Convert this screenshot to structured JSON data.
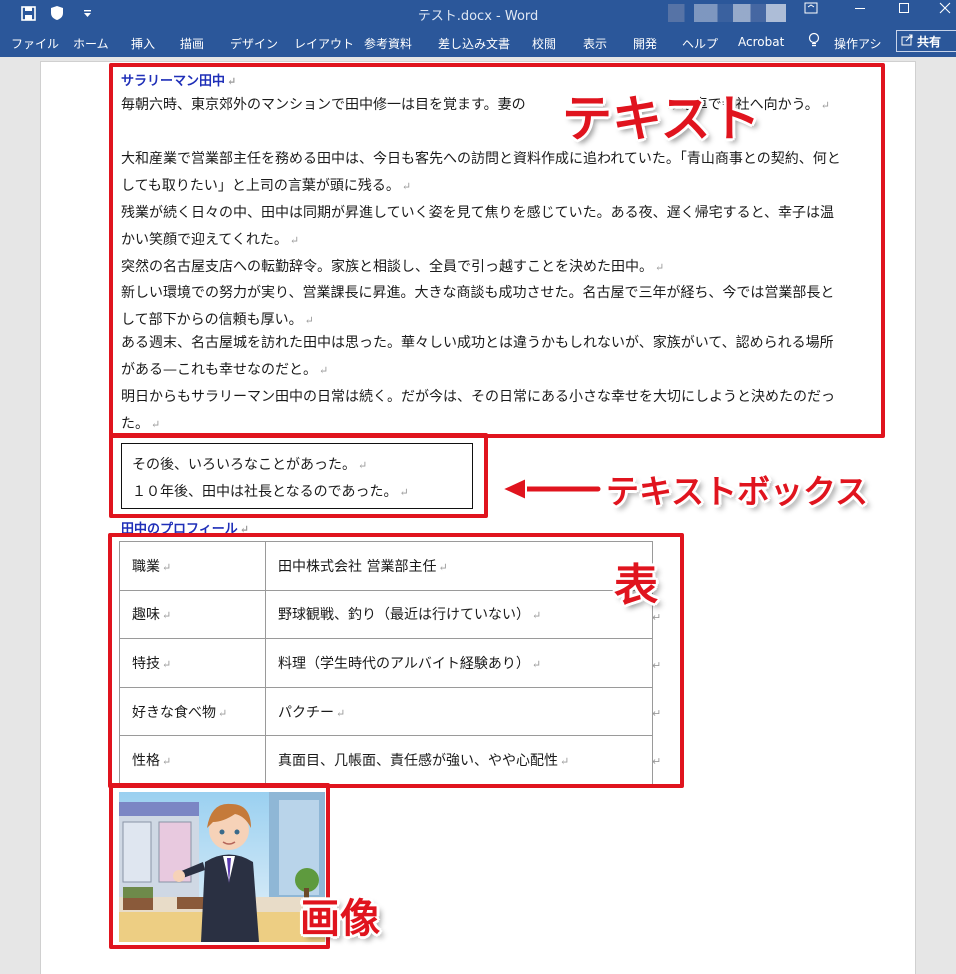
{
  "window": {
    "title": "テスト.docx  -  Word"
  },
  "ribbon": {
    "tabs": [
      "ファイル",
      "ホーム",
      "挿入",
      "描画",
      "デザイン",
      "レイアウト",
      "参考資料",
      "差し込み文書",
      "校閲",
      "表示",
      "開発",
      "ヘルプ",
      "Acrobat"
    ],
    "tell_me": "操作アシ",
    "share": "共有"
  },
  "document": {
    "heading1": "サラリーマン田中",
    "paragraphs": [
      "毎朝六時、東京郊外のマンションで田中修一は目を覚ます。妻の　　　　　　　　　　の電車で会社へ向かう。",
      "大和産業で営業部主任を務める田中は、今日も客先への訪問と資料作成に追われていた。「青山商事との契約、何としても取りたい」と上司の言葉が頭に残る。",
      "残業が続く日々の中、田中は同期が昇進していく姿を見て焦りを感じていた。ある夜、遅く帰宅すると、幸子は温かい笑顔で迎えてくれた。",
      "突然の名古屋支店への転勤辞令。家族と相談し、全員で引っ越すことを決めた田中。",
      "新しい環境での努力が実り、営業課長に昇進。大きな商談も成功させた。名古屋で三年が経ち、今では営業部長として部下からの信頼も厚い。",
      "ある週末、名古屋城を訪れた田中は思った。華々しい成功とは違うかもしれないが、家族がいて、認められる場所がある—これも幸せなのだと。",
      "明日からもサラリーマン田中の日常は続く。だが今は、その日常にある小さな幸せを大切にしようと決めたのだった。"
    ],
    "textbox_lines": [
      "その後、いろいろなことがあった。",
      "１０年後、田中は社長となるのであった。"
    ],
    "heading2": "田中のプロフィール",
    "profile": [
      {
        "key": "職業",
        "value": "田中株式会社 営業部主任"
      },
      {
        "key": "趣味",
        "value": "野球観戦、釣り（最近は行けていない）"
      },
      {
        "key": "特技",
        "value": "料理（学生時代のアルバイト経験あり）"
      },
      {
        "key": "好きな食べ物",
        "value": "パクチー"
      },
      {
        "key": "性格",
        "value": "真面目、几帳面、責任感が強い、やや心配性"
      }
    ],
    "paragraph_mark": "↵"
  },
  "annotations": {
    "text": "テキスト",
    "textbox": "テキストボックス",
    "table": "表",
    "image": "画像"
  },
  "colors": {
    "ribbon": "#2b579a",
    "annotation": "#e0141e",
    "heading": "#1f2fb8"
  }
}
